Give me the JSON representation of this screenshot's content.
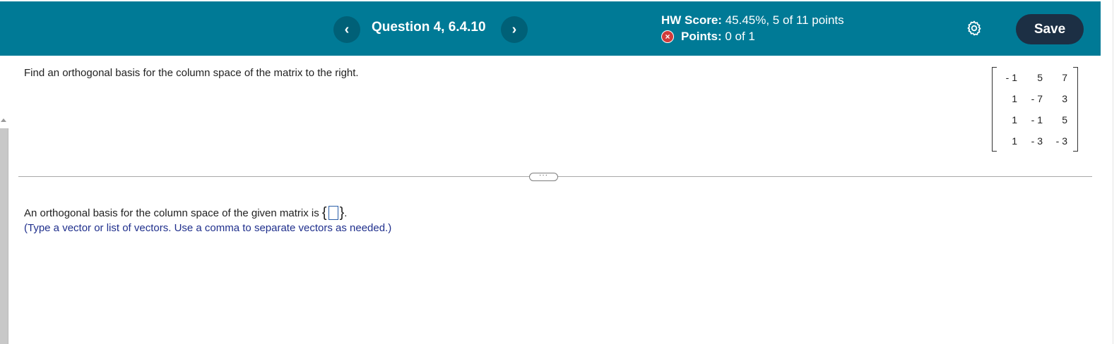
{
  "header": {
    "prev_icon": "‹",
    "question_title": "Question 4, 6.4.10",
    "next_icon": "›",
    "hw_score_label": "HW Score:",
    "hw_score_value": "45.45%, 5 of 11 points",
    "points_icon": "×",
    "points_label": "Points:",
    "points_value": "0 of 1",
    "save_label": "Save",
    "icons": {
      "settings": "gear-icon",
      "status": "incorrect-x-icon"
    },
    "colors": {
      "bar": "#007a96",
      "save": "#1c2f44",
      "error": "#d13b3b"
    }
  },
  "problem": {
    "prompt": "Find an orthogonal basis for the column space of the matrix to the right.",
    "matrix": [
      [
        "- 1",
        "5",
        "7"
      ],
      [
        "1",
        "- 7",
        "3"
      ],
      [
        "1",
        "- 1",
        "5"
      ],
      [
        "1",
        "- 3",
        "- 3"
      ]
    ]
  },
  "divider_handle": "···",
  "answer": {
    "text": "An orthogonal basis for the column space of the given matrix is",
    "open_brace": "{",
    "close_brace": "}",
    "end": ".",
    "hint": "(Type a vector or list of vectors. Use a comma to separate vectors as needed.)",
    "value": ""
  }
}
